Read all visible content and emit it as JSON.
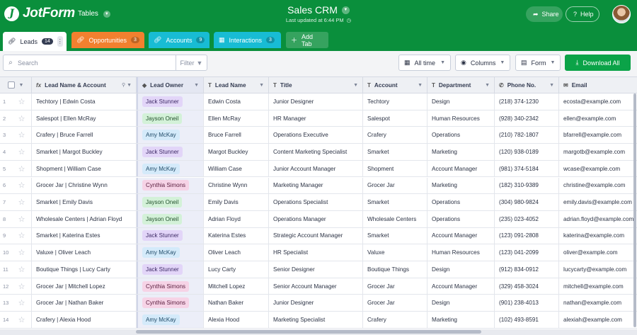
{
  "header": {
    "logo_text": "JotForm",
    "tables_label": "Tables",
    "title": "Sales CRM",
    "last_updated": "Last updated at 6:44 PM",
    "share_label": "Share",
    "help_label": "Help"
  },
  "tabs": [
    {
      "label": "Leads",
      "count": "14"
    },
    {
      "label": "Opportunities",
      "count": "3"
    },
    {
      "label": "Accounts",
      "count": "9"
    },
    {
      "label": "Interactions",
      "count": "3"
    }
  ],
  "add_tab_label": "Add Tab",
  "toolbar": {
    "search_placeholder": "Search",
    "filter_label": "Filter",
    "time_label": "All time",
    "columns_label": "Columns",
    "form_label": "Form",
    "download_label": "Download All"
  },
  "columns": {
    "lead": "Lead Name & Account",
    "owner": "Lead Owner",
    "name": "Lead Name",
    "title": "Title",
    "account": "Account",
    "dept": "Department",
    "phone": "Phone No.",
    "email": "Email"
  },
  "colors": {
    "header_green": "#0a8f3c",
    "opportunities_tab": "#f2802f",
    "accounts_tab": "#18bcd4",
    "download_button": "#0ba348"
  },
  "rows": [
    {
      "num": "1",
      "lead": "Techtory | Edwin Costa",
      "owner": "Jack Stunner",
      "owner_color": "purple",
      "name": "Edwin Costa",
      "title": "Junior Designer",
      "account": "Techtory",
      "dept": "Design",
      "phone": "(218) 374-1230",
      "email": "ecosta@example.com"
    },
    {
      "num": "2",
      "lead": "Salespot | Ellen McRay",
      "owner": "Jayson Oneil",
      "owner_color": "green",
      "name": "Ellen McRay",
      "title": "HR Manager",
      "account": "Salespot",
      "dept": "Human Resources",
      "phone": "(928) 340-2342",
      "email": "ellen@example.com"
    },
    {
      "num": "3",
      "lead": "Crafery | Bruce Farrell",
      "owner": "Amy McKay",
      "owner_color": "blue",
      "name": "Bruce Farrell",
      "title": "Operations Executive",
      "account": "Crafery",
      "dept": "Operations",
      "phone": "(210) 782-1807",
      "email": "bfarrell@example.com"
    },
    {
      "num": "4",
      "lead": "Smarket | Margot Buckley",
      "owner": "Jack Stunner",
      "owner_color": "purple",
      "name": "Margot Buckley",
      "title": "Content Marketing Specialist",
      "account": "Smarket",
      "dept": "Marketing",
      "phone": "(120) 938-0189",
      "email": "margotb@example.com"
    },
    {
      "num": "5",
      "lead": "Shopment | William Case",
      "owner": "Amy McKay",
      "owner_color": "blue",
      "name": "William Case",
      "title": "Junior Account Manager",
      "account": "Shopment",
      "dept": "Account Manager",
      "phone": "(981) 374-5184",
      "email": "wcase@example.com"
    },
    {
      "num": "6",
      "lead": "Grocer Jar | Christine Wynn",
      "owner": "Cynthia Simons",
      "owner_color": "pink",
      "name": "Christine Wynn",
      "title": "Marketing Manager",
      "account": "Grocer Jar",
      "dept": "Marketing",
      "phone": "(182) 310-9389",
      "email": "christine@example.com"
    },
    {
      "num": "7",
      "lead": "Smarket | Emily Davis",
      "owner": "Jayson Oneil",
      "owner_color": "green",
      "name": "Emily Davis",
      "title": "Operations Specialist",
      "account": "Smarket",
      "dept": "Operations",
      "phone": "(304) 980-9824",
      "email": "emily.davis@example.com"
    },
    {
      "num": "8",
      "lead": "Wholesale Centers | Adrian Floyd",
      "owner": "Jayson Oneil",
      "owner_color": "green",
      "name": "Adrian Floyd",
      "title": "Operations Manager",
      "account": "Wholesale Centers",
      "dept": "Operations",
      "phone": "(235) 023-4052",
      "email": "adrian.floyd@example.com"
    },
    {
      "num": "9",
      "lead": "Smarket | Katerina Estes",
      "owner": "Jack Stunner",
      "owner_color": "purple",
      "name": "Katerina Estes",
      "title": "Strategic Account Manager",
      "account": "Smarket",
      "dept": "Account Manager",
      "phone": "(123) 091-2808",
      "email": "katerina@example.com"
    },
    {
      "num": "10",
      "lead": "Valuxe | Oliver Leach",
      "owner": "Amy McKay",
      "owner_color": "blue",
      "name": "Oliver Leach",
      "title": "HR Specialist",
      "account": "Valuxe",
      "dept": "Human Resources",
      "phone": "(123) 041-2099",
      "email": "oliver@example.com"
    },
    {
      "num": "11",
      "lead": "Boutique Things | Lucy Carty",
      "owner": "Jack Stunner",
      "owner_color": "purple",
      "name": "Lucy Carty",
      "title": "Senior Designer",
      "account": "Boutique Things",
      "dept": "Design",
      "phone": "(912) 834-0912",
      "email": "lucycarty@example.com"
    },
    {
      "num": "12",
      "lead": "Grocer Jar | Mitchell Lopez",
      "owner": "Cynthia Simons",
      "owner_color": "pink",
      "name": "Mitchell Lopez",
      "title": "Senior Account Manager",
      "account": "Grocer Jar",
      "dept": "Account Manager",
      "phone": "(329) 458-3024",
      "email": "mitchell@example.com"
    },
    {
      "num": "13",
      "lead": "Grocer Jar | Nathan Baker",
      "owner": "Cynthia Simons",
      "owner_color": "pink",
      "name": "Nathan Baker",
      "title": "Junior Designer",
      "account": "Grocer Jar",
      "dept": "Design",
      "phone": "(901) 238-4013",
      "email": "nathan@example.com"
    },
    {
      "num": "14",
      "lead": "Crafery | Alexia Hood",
      "owner": "Amy McKay",
      "owner_color": "blue",
      "name": "Alexia Hood",
      "title": "Marketing Specialist",
      "account": "Crafery",
      "dept": "Marketing",
      "phone": "(102) 493-8591",
      "email": "alexiah@example.com"
    }
  ]
}
